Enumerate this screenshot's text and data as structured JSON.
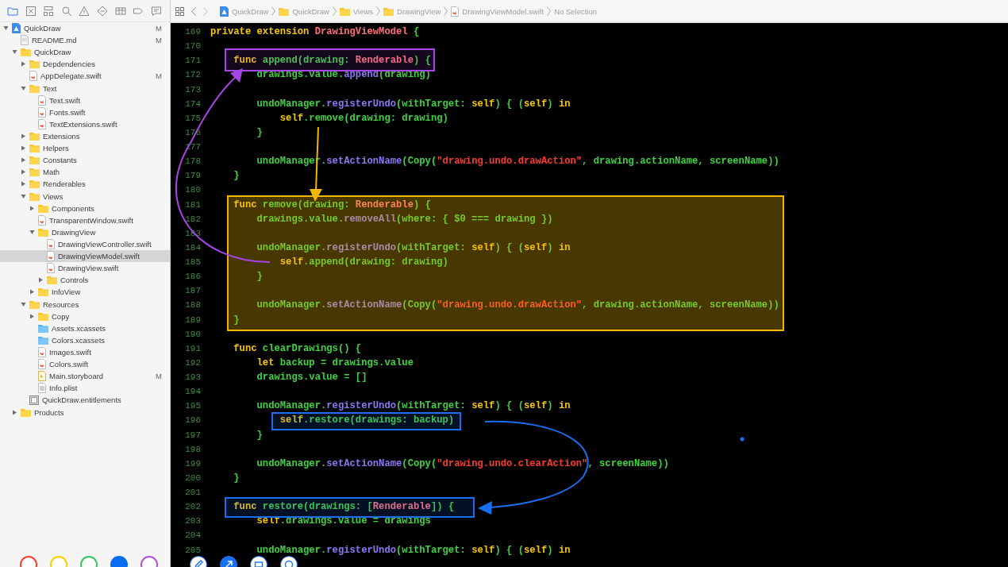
{
  "navigator_tabs": [
    {
      "kind": "folder",
      "selected": true
    },
    {
      "kind": "xbox",
      "selected": false
    },
    {
      "kind": "hierarchy",
      "selected": false
    },
    {
      "kind": "search",
      "selected": false
    },
    {
      "kind": "warning",
      "selected": false
    },
    {
      "kind": "diamond",
      "selected": false
    },
    {
      "kind": "lines",
      "selected": false
    },
    {
      "kind": "tag",
      "selected": false
    },
    {
      "kind": "bubble",
      "selected": false
    }
  ],
  "tree": [
    {
      "name": "QuickDraw",
      "kind": "project",
      "badge": "M",
      "expanded": true,
      "selected": false,
      "children": [
        {
          "name": "README.md",
          "kind": "doc",
          "badge": "M",
          "selected": false
        },
        {
          "name": "QuickDraw",
          "kind": "folder",
          "expanded": true,
          "selected": false,
          "children": [
            {
              "name": "Depdendencies",
              "kind": "folder",
              "expanded": false,
              "selected": false
            },
            {
              "name": "AppDelegate.swift",
              "kind": "swift",
              "badge": "M",
              "selected": false
            },
            {
              "name": "Text",
              "kind": "folder",
              "expanded": true,
              "selected": false,
              "children": [
                {
                  "name": "Text.swift",
                  "kind": "swift",
                  "selected": false
                },
                {
                  "name": "Fonts.swift",
                  "kind": "swift",
                  "selected": false
                },
                {
                  "name": "TextExtensions.swift",
                  "kind": "swift",
                  "selected": false
                }
              ]
            },
            {
              "name": "Extensions",
              "kind": "folder",
              "expanded": false,
              "selected": false
            },
            {
              "name": "Helpers",
              "kind": "folder",
              "expanded": false,
              "selected": false
            },
            {
              "name": "Constants",
              "kind": "folder",
              "expanded": false,
              "selected": false
            },
            {
              "name": "Math",
              "kind": "folder",
              "expanded": false,
              "selected": false
            },
            {
              "name": "Renderables",
              "kind": "folder",
              "expanded": false,
              "selected": false
            },
            {
              "name": "Views",
              "kind": "folder",
              "expanded": true,
              "selected": false,
              "children": [
                {
                  "name": "Components",
                  "kind": "folder",
                  "expanded": false,
                  "selected": false
                },
                {
                  "name": "TransparentWindow.swift",
                  "kind": "swift",
                  "selected": false
                },
                {
                  "name": "DrawingView",
                  "kind": "folder",
                  "expanded": true,
                  "selected": false,
                  "children": [
                    {
                      "name": "DrawingViewController.swift",
                      "kind": "swift",
                      "selected": false
                    },
                    {
                      "name": "DrawingViewModel.swift",
                      "kind": "swift",
                      "selected": true
                    },
                    {
                      "name": "DrawingView.swift",
                      "kind": "swift",
                      "selected": false
                    },
                    {
                      "name": "Controls",
                      "kind": "folder",
                      "expanded": false,
                      "selected": false
                    }
                  ]
                },
                {
                  "name": "InfoView",
                  "kind": "folder",
                  "expanded": false,
                  "selected": false
                }
              ]
            },
            {
              "name": "Resources",
              "kind": "folder",
              "expanded": true,
              "selected": false,
              "children": [
                {
                  "name": "Copy",
                  "kind": "folder",
                  "expanded": false,
                  "selected": false
                },
                {
                  "name": "Assets.xcassets",
                  "kind": "assets",
                  "selected": false
                },
                {
                  "name": "Colors.xcassets",
                  "kind": "assets",
                  "selected": false
                },
                {
                  "name": "Images.swift",
                  "kind": "swift",
                  "selected": false
                },
                {
                  "name": "Colors.swift",
                  "kind": "swift",
                  "selected": false
                },
                {
                  "name": "Main.storyboard",
                  "kind": "storyboard",
                  "badge": "M",
                  "selected": false
                },
                {
                  "name": "Info.plist",
                  "kind": "plist",
                  "selected": false
                }
              ]
            },
            {
              "name": "QuickDraw.entitlements",
              "kind": "entitlements",
              "selected": false
            }
          ]
        },
        {
          "name": "Products",
          "kind": "folder",
          "expanded": false,
          "selected": false
        }
      ]
    }
  ],
  "palette": [
    {
      "color": "#ff3b30",
      "selected": false
    },
    {
      "color": "#ffcc00",
      "selected": false
    },
    {
      "color": "#34c759",
      "selected": false
    },
    {
      "color": "#0a6cf0",
      "selected": true
    },
    {
      "color": "#af52de",
      "selected": false
    }
  ],
  "breadcrumb": [
    {
      "kind": "project",
      "label": "QuickDraw"
    },
    {
      "kind": "folder",
      "label": "QuickDraw"
    },
    {
      "kind": "folder",
      "label": "Views"
    },
    {
      "kind": "folder",
      "label": "DrawingView"
    },
    {
      "kind": "swift",
      "label": "DrawingViewModel.swift"
    },
    {
      "kind": "plain",
      "label": "No Selection"
    }
  ],
  "code": [
    {
      "num": "169",
      "tokens": [
        {
          "kind": "kw",
          "text": "private extension "
        },
        {
          "kind": "type",
          "text": "DrawingViewModel"
        },
        {
          "kind": "id",
          "text": " {"
        }
      ]
    },
    {
      "num": "170"
    },
    {
      "num": "171",
      "tokens": [
        {
          "kind": "kw",
          "text": "    func "
        },
        {
          "kind": "id",
          "text": "append(drawing: "
        },
        {
          "kind": "type",
          "text": "Renderable"
        },
        {
          "kind": "id",
          "text": ") {"
        }
      ]
    },
    {
      "num": "172",
      "tokens": [
        {
          "kind": "id",
          "text": "        drawings.value."
        },
        {
          "kind": "call",
          "text": "append"
        },
        {
          "kind": "id",
          "text": "(drawing)"
        }
      ]
    },
    {
      "num": "173"
    },
    {
      "num": "174",
      "tokens": [
        {
          "kind": "id",
          "text": "        undoManager."
        },
        {
          "kind": "call",
          "text": "registerUndo"
        },
        {
          "kind": "id",
          "text": "(withTarget: "
        },
        {
          "kind": "kw",
          "text": "self"
        },
        {
          "kind": "id",
          "text": ") { ("
        },
        {
          "kind": "kw",
          "text": "self"
        },
        {
          "kind": "id",
          "text": ") "
        },
        {
          "kind": "kw",
          "text": "in"
        }
      ]
    },
    {
      "num": "175",
      "tokens": [
        {
          "kind": "kw",
          "text": "            self"
        },
        {
          "kind": "id",
          "text": ".remove(drawing: drawing)"
        }
      ]
    },
    {
      "num": "176",
      "tokens": [
        {
          "kind": "id",
          "text": "        }"
        }
      ]
    },
    {
      "num": "177"
    },
    {
      "num": "178",
      "tokens": [
        {
          "kind": "id",
          "text": "        undoManager."
        },
        {
          "kind": "call",
          "text": "setActionName"
        },
        {
          "kind": "id",
          "text": "(Copy("
        },
        {
          "kind": "str",
          "text": "\"drawing.undo.drawAction\""
        },
        {
          "kind": "id",
          "text": ", drawing.actionName, screenName))"
        }
      ]
    },
    {
      "num": "179",
      "tokens": [
        {
          "kind": "id",
          "text": "    }"
        }
      ]
    },
    {
      "num": "180"
    },
    {
      "num": "181",
      "tokens": [
        {
          "kind": "kw",
          "text": "    func "
        },
        {
          "kind": "id",
          "text": "remove(drawing: "
        },
        {
          "kind": "type",
          "text": "Renderable"
        },
        {
          "kind": "id",
          "text": ") {"
        }
      ]
    },
    {
      "num": "182",
      "tokens": [
        {
          "kind": "id",
          "text": "        drawings.value."
        },
        {
          "kind": "call",
          "text": "removeAll"
        },
        {
          "kind": "id",
          "text": "(where: { $0 === drawing })"
        }
      ]
    },
    {
      "num": "183"
    },
    {
      "num": "184",
      "tokens": [
        {
          "kind": "id",
          "text": "        undoManager."
        },
        {
          "kind": "call",
          "text": "registerUndo"
        },
        {
          "kind": "id",
          "text": "(withTarget: "
        },
        {
          "kind": "kw",
          "text": "self"
        },
        {
          "kind": "id",
          "text": ") { ("
        },
        {
          "kind": "kw",
          "text": "self"
        },
        {
          "kind": "id",
          "text": ") "
        },
        {
          "kind": "kw",
          "text": "in"
        }
      ]
    },
    {
      "num": "185",
      "tokens": [
        {
          "kind": "kw",
          "text": "            self"
        },
        {
          "kind": "id",
          "text": ".append(drawing: drawing)"
        }
      ]
    },
    {
      "num": "186",
      "tokens": [
        {
          "kind": "id",
          "text": "        }"
        }
      ]
    },
    {
      "num": "187"
    },
    {
      "num": "188",
      "tokens": [
        {
          "kind": "id",
          "text": "        undoManager."
        },
        {
          "kind": "call",
          "text": "setActionName"
        },
        {
          "kind": "id",
          "text": "(Copy("
        },
        {
          "kind": "str",
          "text": "\"drawing.undo.drawAction\""
        },
        {
          "kind": "id",
          "text": ", drawing.actionName, screenName))"
        }
      ]
    },
    {
      "num": "189",
      "tokens": [
        {
          "kind": "id",
          "text": "    }"
        }
      ]
    },
    {
      "num": "190"
    },
    {
      "num": "191",
      "tokens": [
        {
          "kind": "kw",
          "text": "    func "
        },
        {
          "kind": "id",
          "text": "clearDrawings() {"
        }
      ]
    },
    {
      "num": "192",
      "tokens": [
        {
          "kind": "kw",
          "text": "        let "
        },
        {
          "kind": "id",
          "text": "backup = drawings.value"
        }
      ]
    },
    {
      "num": "193",
      "tokens": [
        {
          "kind": "id",
          "text": "        drawings.value = []"
        }
      ]
    },
    {
      "num": "194"
    },
    {
      "num": "195",
      "tokens": [
        {
          "kind": "id",
          "text": "        undoManager."
        },
        {
          "kind": "call",
          "text": "registerUndo"
        },
        {
          "kind": "id",
          "text": "(withTarget: "
        },
        {
          "kind": "kw",
          "text": "self"
        },
        {
          "kind": "id",
          "text": ") { ("
        },
        {
          "kind": "kw",
          "text": "self"
        },
        {
          "kind": "id",
          "text": ") "
        },
        {
          "kind": "kw",
          "text": "in"
        }
      ]
    },
    {
      "num": "196",
      "tokens": [
        {
          "kind": "kw",
          "text": "            self"
        },
        {
          "kind": "id",
          "text": ".restore(drawings: backup)"
        }
      ]
    },
    {
      "num": "197",
      "tokens": [
        {
          "kind": "id",
          "text": "        }"
        }
      ]
    },
    {
      "num": "198"
    },
    {
      "num": "199",
      "tokens": [
        {
          "kind": "id",
          "text": "        undoManager."
        },
        {
          "kind": "call",
          "text": "setActionName"
        },
        {
          "kind": "id",
          "text": "(Copy("
        },
        {
          "kind": "str",
          "text": "\"drawing.undo.clearAction\""
        },
        {
          "kind": "id",
          "text": ", screenName))"
        }
      ]
    },
    {
      "num": "200",
      "tokens": [
        {
          "kind": "id",
          "text": "    }"
        }
      ]
    },
    {
      "num": "201"
    },
    {
      "num": "202",
      "tokens": [
        {
          "kind": "kw",
          "text": "    func "
        },
        {
          "kind": "id",
          "text": "restore(drawings: ["
        },
        {
          "kind": "type",
          "text": "Renderable"
        },
        {
          "kind": "id",
          "text": "]) {"
        }
      ]
    },
    {
      "num": "203",
      "tokens": [
        {
          "kind": "kw",
          "text": "        self"
        },
        {
          "kind": "id",
          "text": ".drawings.value = drawings"
        }
      ]
    },
    {
      "num": "204"
    },
    {
      "num": "205",
      "tokens": [
        {
          "kind": "id",
          "text": "        undoManager."
        },
        {
          "kind": "call",
          "text": "registerUndo"
        },
        {
          "kind": "id",
          "text": "(withTarget: "
        },
        {
          "kind": "kw",
          "text": "self"
        },
        {
          "kind": "id",
          "text": ") { ("
        },
        {
          "kind": "kw",
          "text": "self"
        },
        {
          "kind": "id",
          "text": ") "
        },
        {
          "kind": "kw",
          "text": "in"
        }
      ]
    }
  ],
  "annotations": [
    {
      "kind": "box",
      "color": "#a845e8"
    },
    {
      "kind": "box",
      "color": "#f2b600"
    },
    {
      "kind": "box",
      "color": "#1a6ff0"
    },
    {
      "kind": "box",
      "color": "#1a6ff0"
    },
    {
      "kind": "arrow",
      "color": "#a845e8"
    },
    {
      "kind": "arrow",
      "color": "#f2b600"
    },
    {
      "kind": "arrow",
      "color": "#1a6ff0"
    },
    {
      "kind": "dot",
      "color": "#1a6ff0"
    }
  ],
  "tools": [
    {
      "kind": "pencil",
      "selected": false
    },
    {
      "kind": "arrow",
      "selected": true
    },
    {
      "kind": "rectangle",
      "selected": false
    },
    {
      "kind": "oval",
      "selected": false
    }
  ]
}
